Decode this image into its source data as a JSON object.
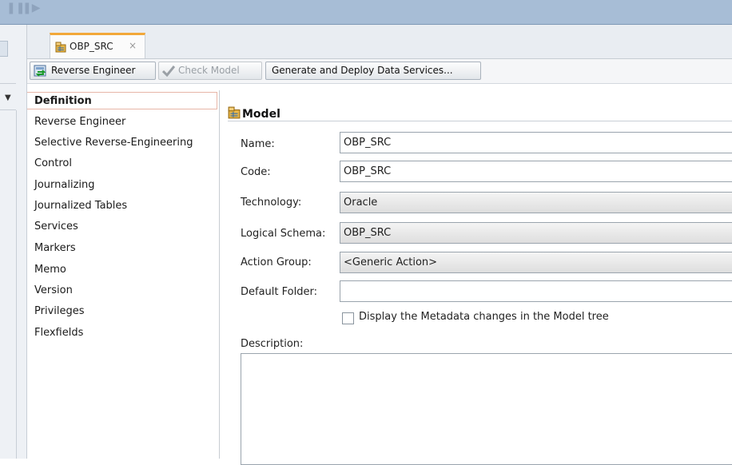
{
  "editor": {
    "tab_title": "OBP_SRC",
    "tab_close": "×"
  },
  "toolbar": {
    "reverse_engineer": "Reverse Engineer",
    "check_model": "Check Model",
    "generate_deploy": "Generate and Deploy Data Services..."
  },
  "nav": {
    "items": [
      {
        "label": "Definition",
        "active": true
      },
      {
        "label": "Reverse Engineer"
      },
      {
        "label": "Selective Reverse-Engineering"
      },
      {
        "label": "Control"
      },
      {
        "label": "Journalizing"
      },
      {
        "label": "Journalized Tables"
      },
      {
        "label": "Services"
      },
      {
        "label": "Markers"
      },
      {
        "label": "Memo"
      },
      {
        "label": "Version"
      },
      {
        "label": "Privileges"
      },
      {
        "label": "Flexfields"
      }
    ]
  },
  "panel": {
    "title": "Model",
    "name_label": "Name:",
    "name_value": "OBP_SRC",
    "code_label": "Code:",
    "code_value": "OBP_SRC",
    "technology_label": "Technology:",
    "technology_value": "Oracle",
    "logical_schema_label": "Logical Schema:",
    "logical_schema_value": "OBP_SRC",
    "action_group_label": "Action Group:",
    "action_group_value": "<Generic Action>",
    "default_folder_label": "Default Folder:",
    "default_folder_value": "",
    "display_metadata_label": "Display the Metadata changes in the Model tree",
    "display_metadata_checked": false,
    "description_label": "Description:",
    "description_value": ""
  },
  "colors": {
    "topbar": "#a7bdd6",
    "active_tab_accent": "#f2a83a",
    "active_nav_border": "#e7b6a8"
  }
}
